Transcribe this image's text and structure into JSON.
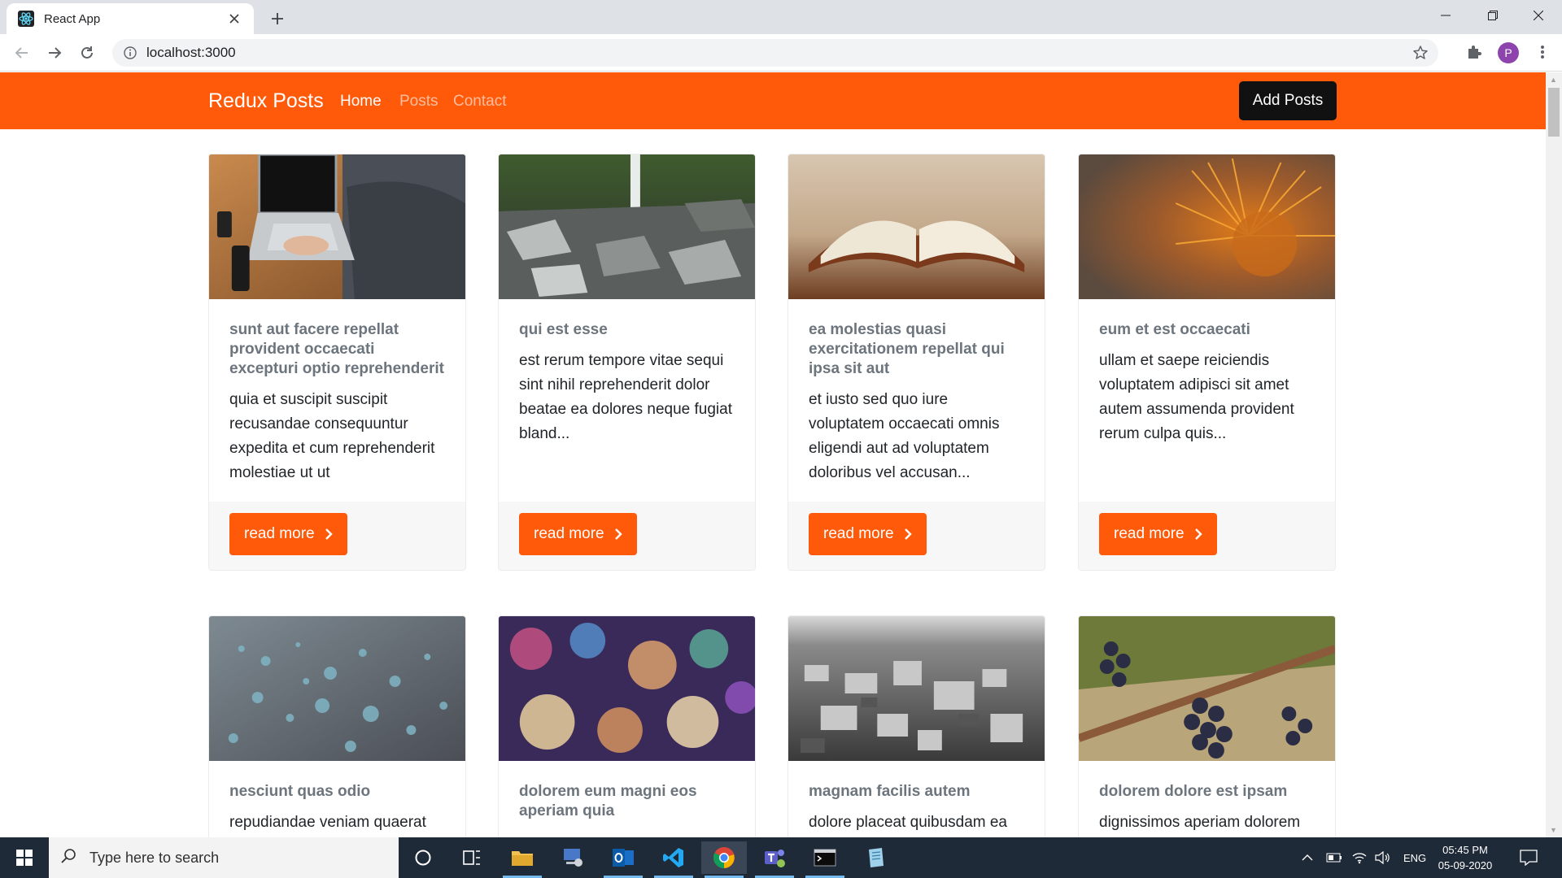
{
  "browser": {
    "tab_title": "React App",
    "url": "localhost:3000",
    "profile_initial": "P"
  },
  "app": {
    "brand": "Redux Posts",
    "nav": [
      {
        "label": "Home",
        "active": true
      },
      {
        "label": "Posts",
        "active": false
      },
      {
        "label": "Contact",
        "active": false
      }
    ],
    "add_button": "Add Posts",
    "read_more_label": "read more",
    "posts": [
      {
        "title": "sunt aut facere repellat provident occaecati excepturi optio reprehenderit",
        "excerpt": "quia et suscipit suscipit recusandae consequuntur expedita et cum reprehenderit molestiae ut ut",
        "image": "laptop-photo"
      },
      {
        "title": "qui est esse",
        "excerpt": "est rerum tempore vitae sequi sint nihil reprehenderit dolor beatae ea dolores neque fugiat bland...",
        "image": "waterfall-rocks-photo"
      },
      {
        "title": "ea molestias quasi exercitationem repellat qui ipsa sit aut",
        "excerpt": "et iusto sed quo iure voluptatem occaecati omnis eligendi aut ad voluptatem doloribus vel accusan...",
        "image": "open-book-photo"
      },
      {
        "title": "eum et est occaecati",
        "excerpt": "ullam et saepe reiciendis voluptatem adipisci sit amet autem assumenda provident rerum culpa quis...",
        "image": "chestnut-burr-photo"
      },
      {
        "title": "nesciunt quas odio",
        "excerpt": "repudiandae veniam quaerat",
        "image": "water-droplets-photo"
      },
      {
        "title": "dolorem eum magni eos aperiam quia",
        "excerpt": "",
        "image": "bokeh-lights-photo"
      },
      {
        "title": "magnam facilis autem",
        "excerpt": "dolore placeat quibusdam ea",
        "image": "city-aerial-photo"
      },
      {
        "title": "dolorem dolore est ipsam",
        "excerpt": "dignissimos aperiam dolorem",
        "image": "grapes-photo"
      }
    ]
  },
  "taskbar": {
    "search_placeholder": "Type here to search",
    "language": "ENG",
    "time": "05:45 PM",
    "date": "05-09-2020"
  }
}
